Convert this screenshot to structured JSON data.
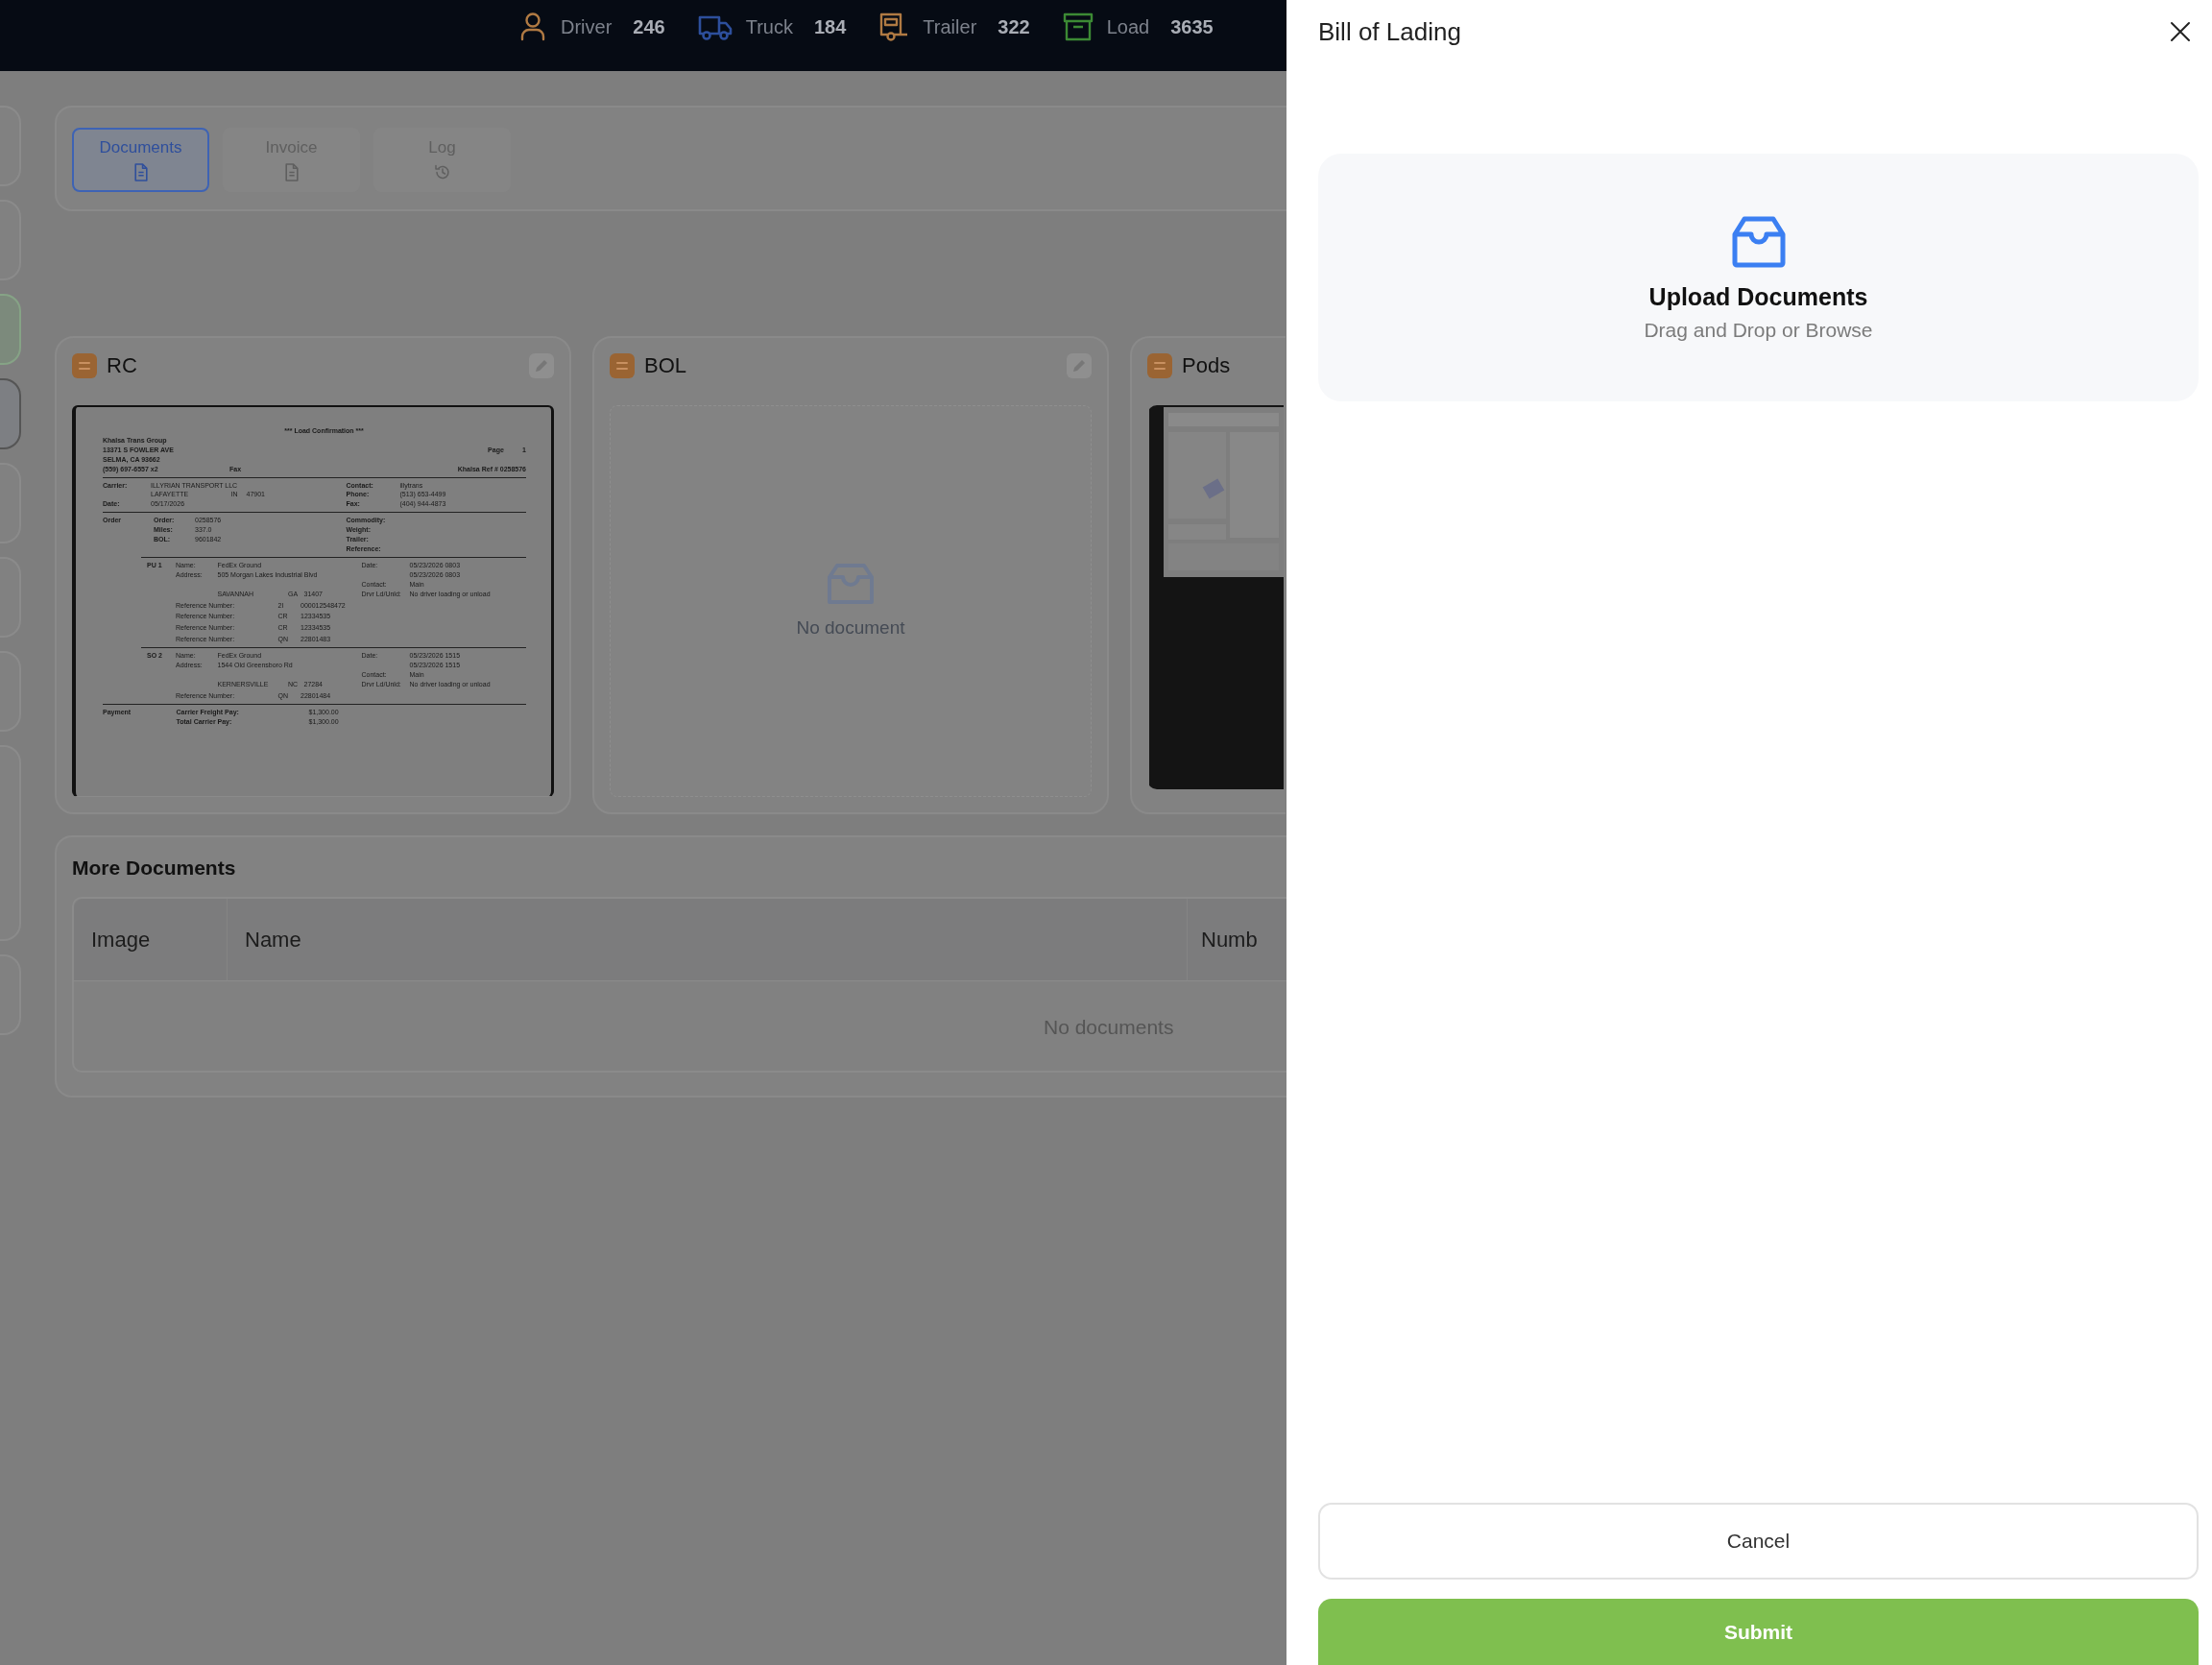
{
  "top_bar": {
    "stats": [
      {
        "kind": "driver",
        "label": "Driver",
        "count": "246"
      },
      {
        "kind": "truck",
        "label": "Truck",
        "count": "184"
      },
      {
        "kind": "trailer",
        "label": "Trailer",
        "count": "322"
      },
      {
        "kind": "load",
        "label": "Load",
        "count": "3635"
      }
    ]
  },
  "tabs": [
    {
      "kind": "document",
      "label": "Documents",
      "selected": true
    },
    {
      "kind": "document",
      "label": "Invoice",
      "selected": false
    },
    {
      "kind": "history",
      "label": "Log",
      "selected": false
    }
  ],
  "document_cards": [
    {
      "title": "RC",
      "kind": "preview",
      "edit_button": true,
      "document": [
        {
          "kind": "title",
          "text": "*** Load Confirmation ***"
        },
        {
          "kind": "head",
          "left": "Khalsa Trans Group"
        },
        {
          "kind": "head",
          "left": "13371 S FOWLER AVE",
          "page": "Page",
          "page_no": "1"
        },
        {
          "kind": "head",
          "left": "SELMA, CA 93662"
        },
        {
          "kind": "head",
          "left": "(559) 697-6557 x2",
          "mid": "Fax",
          "right": "Khalsa Ref # 0258576"
        },
        {
          "kind": "rule"
        },
        {
          "kind": "field",
          "label": "Carrier:",
          "value": "ILLYRIAN TRANSPORT LLC",
          "label2": "Contact:",
          "value2": "illytrans"
        },
        {
          "kind": "field",
          "value": "LAFAYETTE",
          "state": "IN",
          "zip": "47901",
          "label2": "Phone:",
          "value2": "(513) 653-4499"
        },
        {
          "kind": "field",
          "label": "Date:",
          "value": "05/17/2026",
          "label2": "Fax:",
          "value2": "(404) 944-4873"
        },
        {
          "kind": "rule"
        },
        {
          "kind": "order",
          "section": "Order",
          "label": "Order:",
          "value": "0258576",
          "label2": "Commodity:"
        },
        {
          "kind": "order",
          "label": "Miles:",
          "value": "337.0",
          "label2": "Weight:"
        },
        {
          "kind": "order",
          "label": "BOL:",
          "value": "9601842",
          "label2": "Trailer:"
        },
        {
          "kind": "order",
          "label2": "Reference:"
        },
        {
          "kind": "rule_indent"
        },
        {
          "kind": "stop",
          "stop": "PU 1",
          "label": "Name:",
          "value": "FedEx Ground",
          "label2": "Date:",
          "value2": "05/23/2026 0803"
        },
        {
          "kind": "stop",
          "label": "Address:",
          "value": "505 Morgan Lakes Industrial Blvd",
          "value2": "05/23/2026 0803"
        },
        {
          "kind": "stop",
          "label2": "Contact:",
          "value2": "Main"
        },
        {
          "kind": "stop",
          "value": "SAVANNAH",
          "state": "GA",
          "zip": "31407",
          "label2": "Drvr Ld/Unld:",
          "value2": "No driver loading or unload"
        },
        {
          "kind": "ref",
          "label": "Reference Number:",
          "code": "2I",
          "value": "000012548472"
        },
        {
          "kind": "ref",
          "label": "Reference Number:",
          "code": "CR",
          "value": "12334535"
        },
        {
          "kind": "ref",
          "label": "Reference Number:",
          "code": "CR",
          "value": "12334535"
        },
        {
          "kind": "ref",
          "label": "Reference Number:",
          "code": "QN",
          "value": "22801483"
        },
        {
          "kind": "rule_indent"
        },
        {
          "kind": "stop",
          "stop": "SO 2",
          "label": "Name:",
          "value": "FedEx Ground",
          "label2": "Date:",
          "value2": "05/23/2026 1515"
        },
        {
          "kind": "stop",
          "label": "Address:",
          "value": "1544 Old Greensboro Rd",
          "value2": "05/23/2026 1515"
        },
        {
          "kind": "stop",
          "label2": "Contact:",
          "value2": "Main"
        },
        {
          "kind": "stop",
          "value": "KERNERSVILLE",
          "state": "NC",
          "zip": "27284",
          "label2": "Drvr Ld/Unld:",
          "value2": "No driver loading or unload"
        },
        {
          "kind": "ref",
          "label": "Reference Number:",
          "code": "QN",
          "value": "22801484"
        },
        {
          "kind": "rule"
        },
        {
          "kind": "payment",
          "section": "Payment",
          "label": "Carrier Freight Pay:",
          "value": "$1,300.00"
        },
        {
          "kind": "payment",
          "label": "Total Carrier Pay:",
          "value": "$1,300.00"
        }
      ]
    },
    {
      "title": "BOL",
      "kind": "empty",
      "edit_button": true,
      "empty_text": "No document"
    },
    {
      "title": "Pods",
      "kind": "picture",
      "edit_button": false
    }
  ],
  "more_documents": {
    "title": "More Documents",
    "columns": [
      "Image",
      "Name",
      "Numb"
    ],
    "empty_text": "No documents"
  },
  "drawer": {
    "title": "Bill of Lading",
    "upload": {
      "title": "Upload Documents",
      "hint": "Drag and Drop or Browse"
    },
    "buttons": [
      {
        "kind": "secondary",
        "label": "Cancel"
      },
      {
        "kind": "primary",
        "label": "Submit"
      }
    ]
  }
}
